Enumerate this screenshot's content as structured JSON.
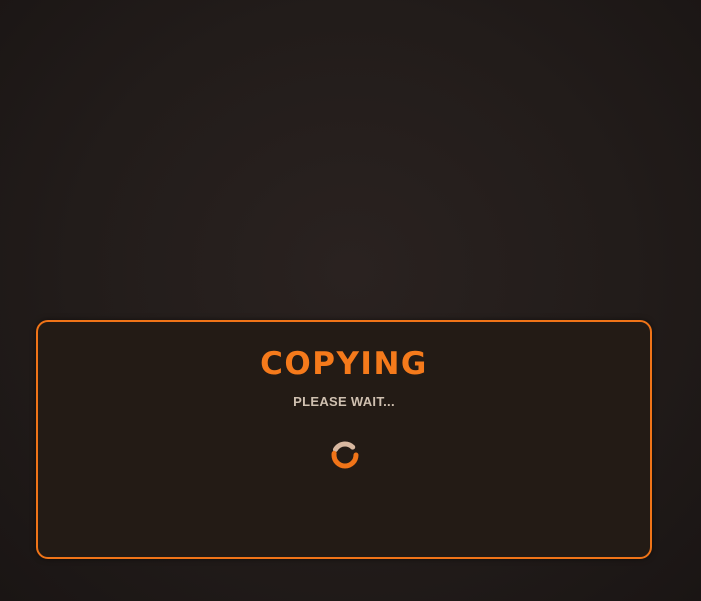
{
  "dialog": {
    "title": "COPYING",
    "subtitle": "PLEASE WAIT..."
  },
  "spinner": {
    "icon": "loading-spinner-icon",
    "colors": {
      "primary": "#f07418",
      "secondary": "#d8b8a0"
    }
  },
  "colors": {
    "accent": "#f07418",
    "background": "#221c1a",
    "panel": "#231b15",
    "subtitle_text": "#cfc0b0"
  }
}
